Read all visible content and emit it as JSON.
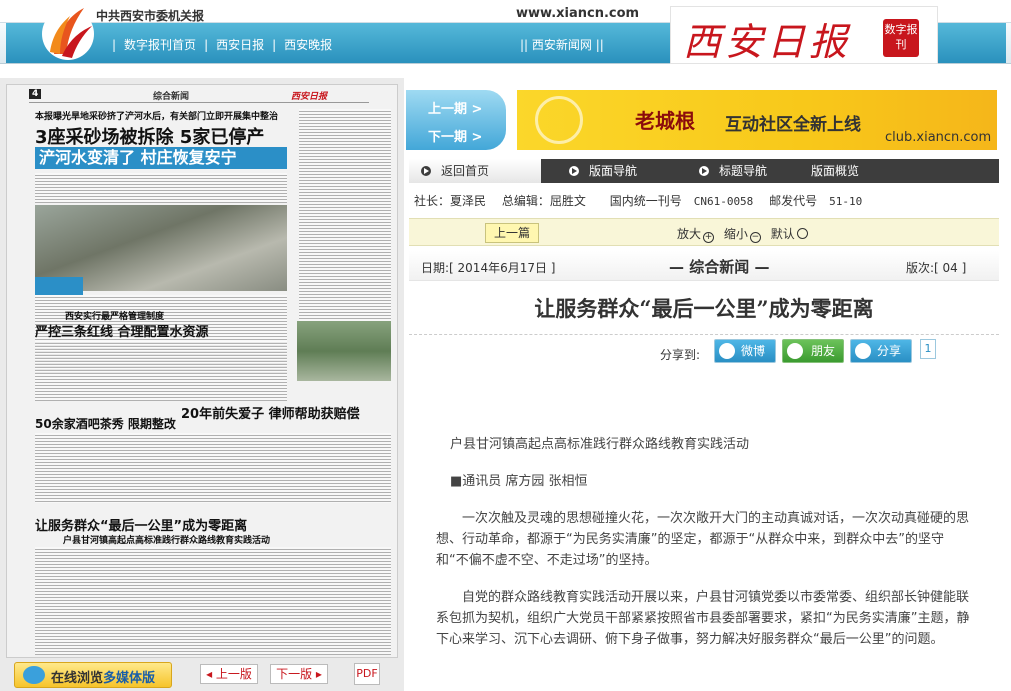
{
  "header": {
    "org": "中共西安市委机关报",
    "site_url": "www.xiancn.com",
    "nav": [
      "数字报刊首页",
      "西安日报",
      "西安晚报"
    ],
    "nav_right": "|| 西安新闻网 ||",
    "brand_name": "西安日报",
    "brand_badge": "数字报刊"
  },
  "newspaper_page": {
    "page_no": "4",
    "section": "综合新闻",
    "paper_name": "西安日报",
    "headlines": [
      "本报曝光旱地采砂挤了浐河水后，有关部门立即开展集中整治",
      "3座采砂场被拆除 5家已停产",
      "浐河水变清了 村庄恢复安宁",
      "西安实行最严格管理制度",
      "严控三条红线 合理配置水资源",
      "50余家酒吧茶秀 限期整改",
      "20年前失爱子 律师帮助获赔偿",
      "让服务群众“最后一公里”成为零距离",
      "户县甘河镇高起点高标准践行群众路线教育实践活动"
    ]
  },
  "bottom_bar": {
    "multimedia": "在线浏览",
    "multimedia_bold": "多媒体版",
    "prev_page": "上一版",
    "next_page": "下一版",
    "pdf": "PDF"
  },
  "page_nav": {
    "prev": "上一期 >",
    "next": "下一期 >"
  },
  "ad": {
    "brand": "老城根",
    "slogan": "互动社区全新上线",
    "url": "club.xiancn.com"
  },
  "tabs": [
    {
      "label": "返回首页",
      "active": true
    },
    {
      "label": "版面导航",
      "active": false
    },
    {
      "label": "标题导航",
      "active": false
    },
    {
      "label": "版面概览",
      "active": false
    }
  ],
  "meta": {
    "president": "社长：夏泽民",
    "editor": "总编辑：屈胜文",
    "cn_label": "国内统一刊号",
    "cn_value": "CN61-0058",
    "postal_label": "邮发代号",
    "postal_value": "51-10"
  },
  "toolbar": {
    "prev_article": "上一篇",
    "zoom_in": "放大",
    "zoom_out": "缩小",
    "default": "默认"
  },
  "dateline": {
    "date": "日期:[ 2014年6月17日 ]",
    "section": "— 综合新闻 —",
    "page": "版次:[ 04 ]"
  },
  "article": {
    "title": "让服务群众“最后一公里”成为零距离",
    "share_label": "分享到:",
    "share_weibo": "微博",
    "share_friends": "朋友",
    "share_more": "分享",
    "share_count": "1",
    "subtitle": "户县甘河镇高起点高标准践行群众路线教育实践活动",
    "byline": "■通讯员 席方园 张相恒",
    "para1": "一次次触及灵魂的思想碰撞火花，一次次敞开大门的主动真诚对话，一次次动真碰硬的思想、行动革命，都源于“为民务实清廉”的坚定，都源于“从群众中来，到群众中去”的坚守和“不偏不虚不空、不走过场”的坚持。",
    "para2": "自党的群众路线教育实践活动开展以来，户县甘河镇党委以市委常委、组织部长钟健能联系包抓为契机，组织广大党员干部紧紧按照省市县委部署要求，紧扣“为民务实清廉”主题，静下心来学习、沉下心去调研、俯下身子做事，努力解决好服务群众“最后一公里”的问题。"
  }
}
